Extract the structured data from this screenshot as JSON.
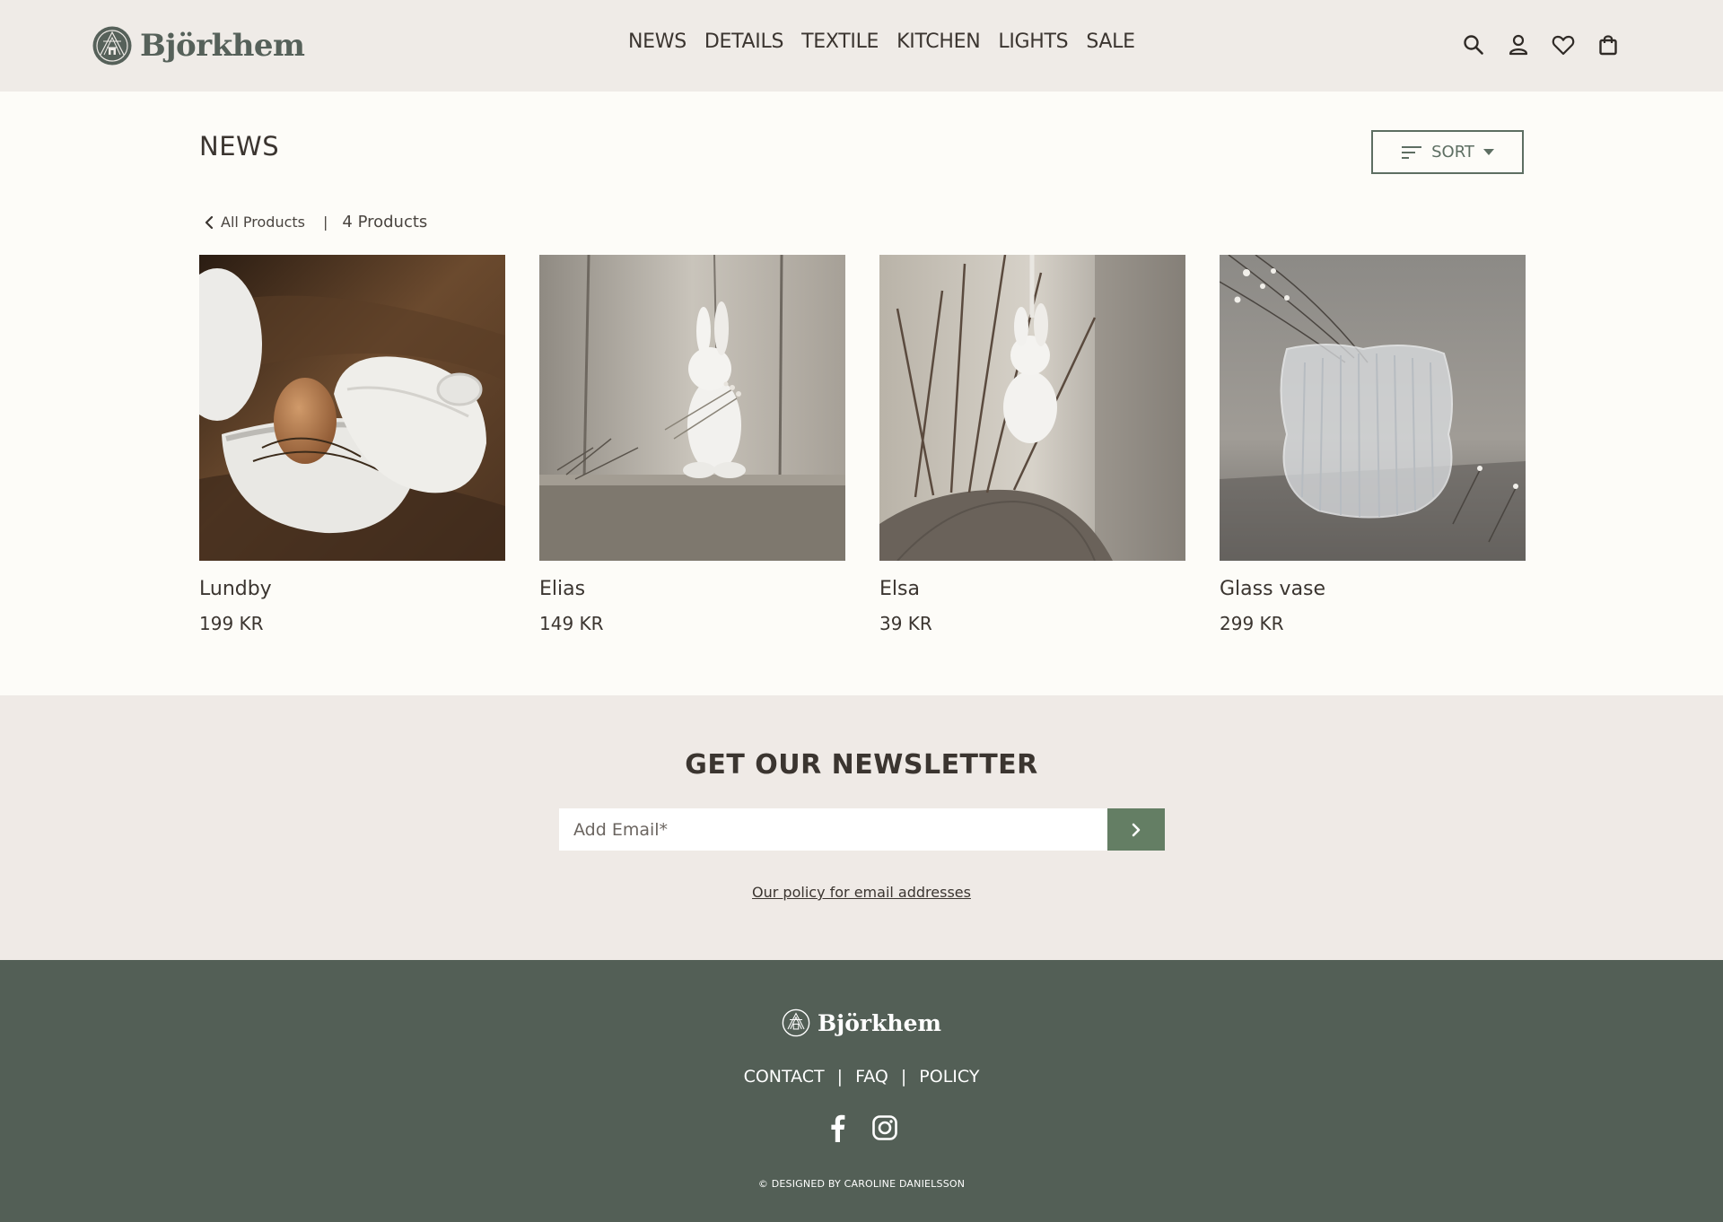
{
  "header": {
    "logo_text": "Björkhem",
    "nav": [
      "NEWS",
      "DETAILS",
      "TEXTILE",
      "KITCHEN",
      "LIGHTS",
      "SALE"
    ],
    "icons": [
      "search-icon",
      "account-icon",
      "wishlist-heart-icon",
      "shopping-bag-icon"
    ]
  },
  "main": {
    "title": "NEWS",
    "sort_label": "SORT",
    "breadcrumb": {
      "back_label": "All Products",
      "separator": "|",
      "count_label": "4 Products"
    },
    "products": [
      {
        "name": "Lundby",
        "price": "199 KR",
        "image": "white ceramic egg cup with brown egg on burlap"
      },
      {
        "name": "Elias",
        "price": "149 KR",
        "image": "white ceramic rabbit figurine holding dried flowers"
      },
      {
        "name": "Elsa",
        "price": "39 KR",
        "image": "white hanging rabbit ornament on branches"
      },
      {
        "name": "Glass vase",
        "price": "299 KR",
        "image": "ribbed clear glass vase with dried flowers"
      }
    ]
  },
  "newsletter": {
    "title": "GET OUR NEWSLETTER",
    "email_placeholder": "Add Email*",
    "policy_link": "Our policy for email addresses"
  },
  "footer": {
    "logo_text": "Björkhem",
    "links": [
      "CONTACT",
      "FAQ",
      "POLICY"
    ],
    "separator": "|",
    "social": [
      "facebook-icon",
      "instagram-icon"
    ],
    "copyright": "© DESIGNED BY CAROLINE DANIELSSON"
  },
  "colors": {
    "header_bg": "#efebe7",
    "page_bg": "#fdfcf8",
    "brand_green": "#56615a",
    "accent_green": "#647e64",
    "footer_bg": "#535f56",
    "text": "#3b3530"
  }
}
